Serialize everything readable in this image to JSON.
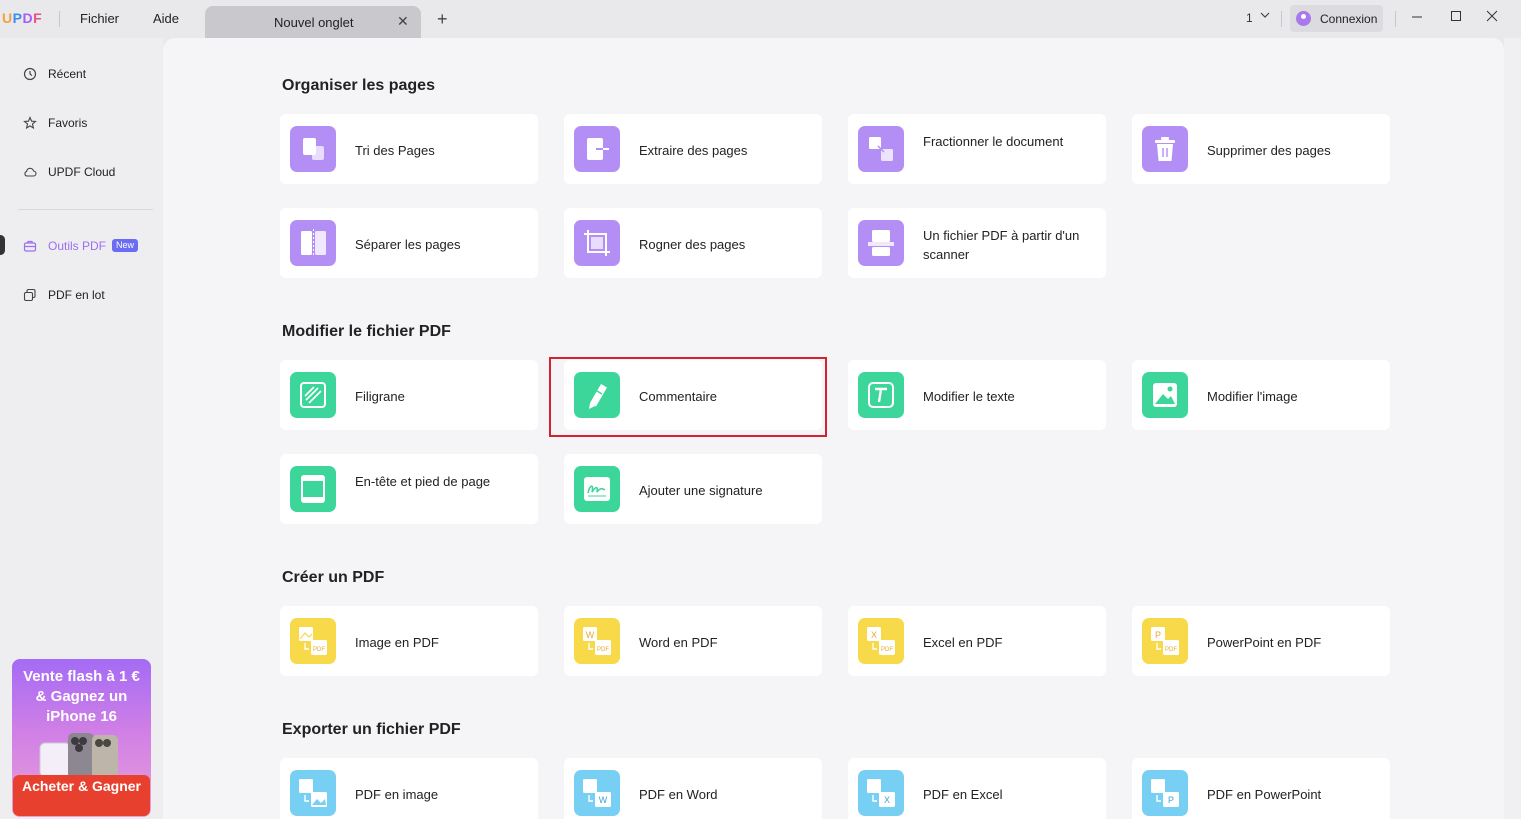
{
  "app": {
    "logo": "UPDF",
    "menu": [
      "Fichier",
      "Aide"
    ],
    "tab_title": "Nouvel onglet",
    "tab_close": "✕",
    "new_tab": "+",
    "tab_count": "1",
    "login_label": "Connexion"
  },
  "sidebar": {
    "items": [
      {
        "label": "Récent",
        "icon": "clock-icon"
      },
      {
        "label": "Favoris",
        "icon": "star-icon"
      },
      {
        "label": "UPDF Cloud",
        "icon": "cloud-icon"
      },
      {
        "label": "Outils PDF",
        "icon": "toolbox-icon",
        "badge": "New",
        "active": true
      },
      {
        "label": "PDF en lot",
        "icon": "batch-icon"
      }
    ],
    "promo": {
      "title": "Vente flash à 1 € & Gagnez un iPhone 16",
      "button": "Acheter & Gagner"
    }
  },
  "sections": [
    {
      "title": "Organiser les pages",
      "tools": [
        {
          "label": "Tri des Pages",
          "color": "purple",
          "icon": "page-sort-icon"
        },
        {
          "label": "Extraire des pages",
          "color": "purple",
          "icon": "extract-pages-icon"
        },
        {
          "label": "Fractionner le document",
          "color": "purple",
          "icon": "split-document-icon"
        },
        {
          "label": "Supprimer des pages",
          "color": "purple",
          "icon": "trash-icon"
        },
        {
          "label": "Séparer les pages",
          "color": "purple",
          "icon": "separate-pages-icon"
        },
        {
          "label": "Rogner des pages",
          "color": "purple",
          "icon": "crop-pages-icon"
        },
        {
          "label": "Un fichier PDF à partir d'un scanner",
          "color": "purple",
          "icon": "scanner-icon"
        }
      ]
    },
    {
      "title": "Modifier le fichier PDF",
      "tools": [
        {
          "label": "Filigrane",
          "color": "green",
          "icon": "watermark-icon"
        },
        {
          "label": "Commentaire",
          "color": "green",
          "icon": "comment-pen-icon"
        },
        {
          "label": "Modifier le texte",
          "color": "green",
          "icon": "edit-text-icon"
        },
        {
          "label": "Modifier l'image",
          "color": "green",
          "icon": "edit-image-icon"
        },
        {
          "label": "En-tête et pied de page",
          "color": "green",
          "icon": "header-footer-icon"
        },
        {
          "label": "Ajouter une signature",
          "color": "green",
          "icon": "signature-icon"
        }
      ]
    },
    {
      "title": "Créer un PDF",
      "tools": [
        {
          "label": "Image en PDF",
          "color": "yellow",
          "icon": "image-to-pdf-icon"
        },
        {
          "label": "Word en PDF",
          "color": "yellow",
          "icon": "word-to-pdf-icon"
        },
        {
          "label": "Excel en PDF",
          "color": "yellow",
          "icon": "excel-to-pdf-icon"
        },
        {
          "label": "PowerPoint en PDF",
          "color": "yellow",
          "icon": "powerpoint-to-pdf-icon"
        }
      ]
    },
    {
      "title": "Exporter un fichier PDF",
      "tools": [
        {
          "label": "PDF en image",
          "color": "blue",
          "icon": "pdf-to-image-icon"
        },
        {
          "label": "PDF en Word",
          "color": "blue",
          "icon": "pdf-to-word-icon"
        },
        {
          "label": "PDF en Excel",
          "color": "blue",
          "icon": "pdf-to-excel-icon"
        },
        {
          "label": "PDF en PowerPoint",
          "color": "blue",
          "icon": "pdf-to-powerpoint-icon"
        }
      ]
    }
  ],
  "icon_letters": {
    "pdf": "PDF",
    "word": "W",
    "excel": "X",
    "powerpoint": "P"
  },
  "colors": {
    "accent": "#9d6ef0",
    "purple": "#b38ef4",
    "green": "#3cd69a",
    "yellow": "#f7d94a",
    "blue": "#78cff4",
    "highlight": "#d4232f"
  }
}
